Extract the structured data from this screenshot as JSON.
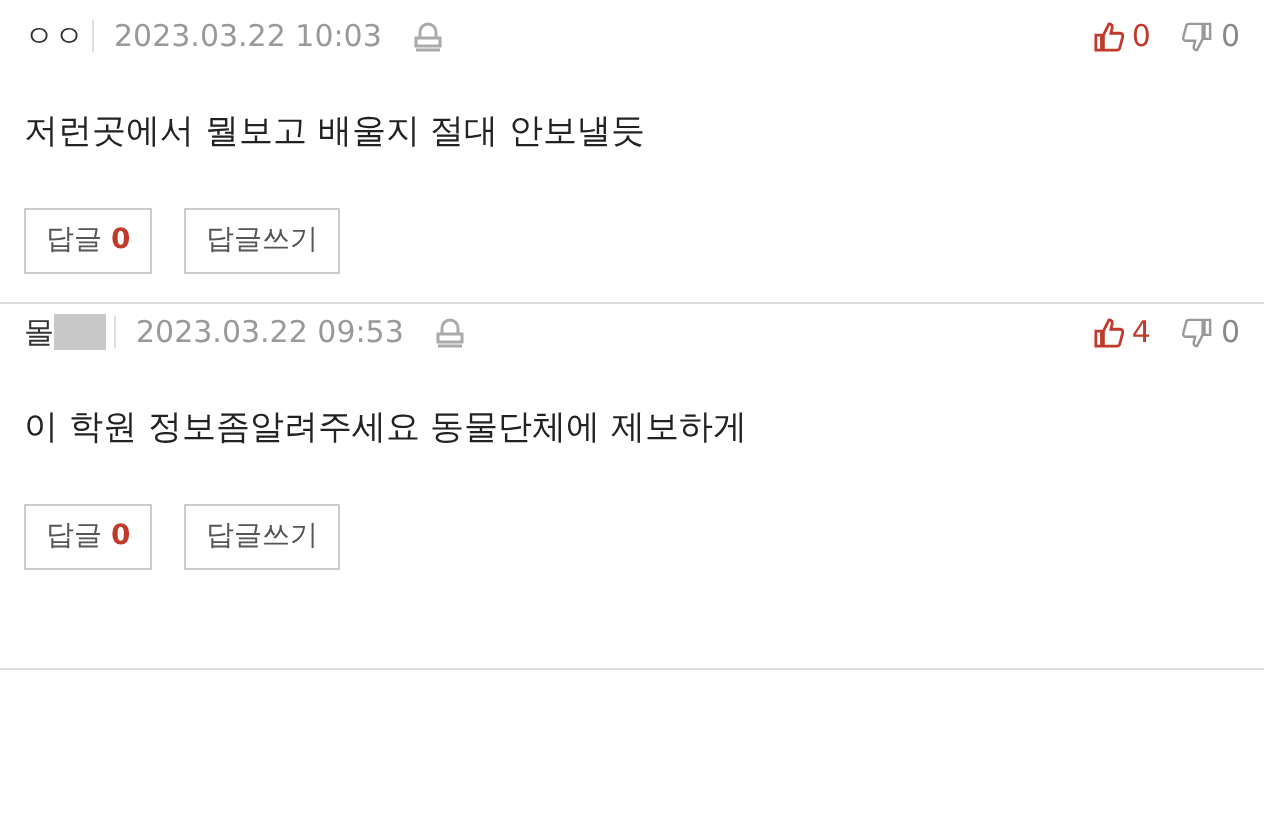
{
  "comments": [
    {
      "author": "ㅇㅇ",
      "redacted": false,
      "date": "2023.03.22 10:03",
      "likes": "0",
      "dislikes": "0",
      "text": "저런곳에서 뭘보고 배울지 절대 안보낼듯",
      "reply_label": "답글",
      "reply_count": "0",
      "write_reply": "답글쓰기"
    },
    {
      "author": "몰",
      "redacted": true,
      "date": "2023.03.22 09:53",
      "likes": "4",
      "dislikes": "0",
      "text": "이 학원 정보좀알려주세요 동물단체에 제보하게",
      "reply_label": "답글",
      "reply_count": "0",
      "write_reply": "답글쓰기"
    }
  ]
}
